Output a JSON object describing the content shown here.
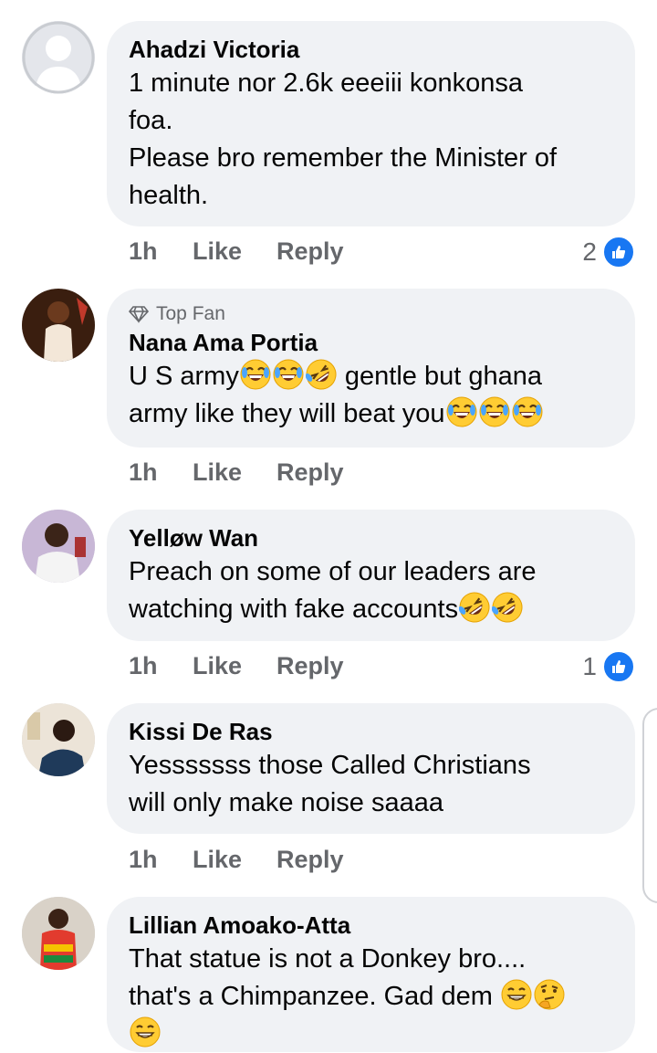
{
  "comments": [
    {
      "name": "Ahadzi Victoria",
      "badge": "",
      "text": "1 minute nor 2.6k eeeiii konkonsa\nfoa.\nPlease bro remember the Minister of\nhealth.",
      "time": "1h",
      "like": "Like",
      "reply": "Reply",
      "reactions": "2"
    },
    {
      "name": "Nana Ama Portia",
      "badge": "Top Fan",
      "text_line1": "U S army",
      "text_line1_after": " gentle but ghana",
      "text_line2": "army like they will beat you",
      "time": "1h",
      "like": "Like",
      "reply": "Reply",
      "reactions": ""
    },
    {
      "name": "Yelløw Wan",
      "badge": "",
      "text_line1": "Preach on some of our leaders are",
      "text_line2": "watching with fake accounts",
      "time": "1h",
      "like": "Like",
      "reply": "Reply",
      "reactions": "1"
    },
    {
      "name": "Kissi De Ras",
      "badge": "",
      "text": "Yesssssss those Called Christians\nwill only make noise saaaa",
      "time": "1h",
      "like": "Like",
      "reply": "Reply",
      "reactions": ""
    },
    {
      "name": "Lillian Amoako-Atta",
      "badge": "",
      "text_line1": "That statue is not a Donkey bro....",
      "text_line2": "that's a Chimpanzee. Gad dem ",
      "time": "",
      "like": "",
      "reply": "",
      "reactions": ""
    }
  ],
  "colors": {
    "accent": "#1877f2",
    "bubble": "#f0f2f5",
    "meta": "#65676b"
  },
  "icons": {
    "like": "thumbs-up-icon",
    "topfan": "diamond-icon"
  }
}
